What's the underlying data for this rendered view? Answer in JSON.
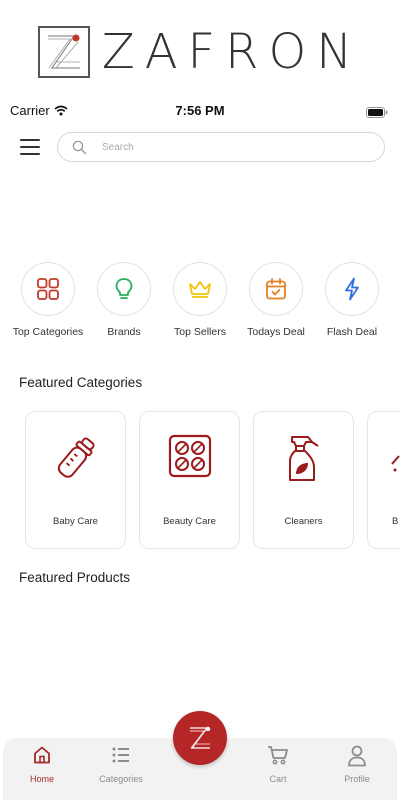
{
  "brand": {
    "name": "ZAFRON"
  },
  "status_bar": {
    "carrier": "Carrier",
    "time": "7:56 PM"
  },
  "search": {
    "placeholder": "Search"
  },
  "quick_actions": [
    {
      "label": "Top Categories",
      "icon": "grid-icon",
      "color": "#c0392b"
    },
    {
      "label": "Brands",
      "icon": "lightbulb-icon",
      "color": "#27ae60"
    },
    {
      "label": "Top Sellers",
      "icon": "crown-icon",
      "color": "#f1c40f"
    },
    {
      "label": "Todays Deal",
      "icon": "calendar-check-icon",
      "color": "#e67e22"
    },
    {
      "label": "Flash Deal",
      "icon": "lightning-icon",
      "color": "#2f6fe0"
    }
  ],
  "featured_categories": {
    "title": "Featured Categories",
    "items": [
      {
        "label": "Baby Care",
        "icon": "baby-bottle-icon"
      },
      {
        "label": "Beauty Care",
        "icon": "palette-icon"
      },
      {
        "label": "Cleaners",
        "icon": "spray-bottle-icon"
      },
      {
        "label": "B",
        "icon": "partial-icon"
      }
    ]
  },
  "featured_products": {
    "title": "Featured Products"
  },
  "bottom_nav": {
    "items": [
      {
        "label": "Home",
        "icon": "home-icon",
        "active": true
      },
      {
        "label": "Categories",
        "icon": "list-icon",
        "active": false
      },
      {
        "label": "Cart",
        "icon": "cart-icon",
        "active": false
      },
      {
        "label": "Profile",
        "icon": "user-icon",
        "active": false
      }
    ]
  },
  "colors": {
    "accent": "#a52a2a",
    "fab": "#b52626",
    "icon_red": "#9b1c1c"
  }
}
